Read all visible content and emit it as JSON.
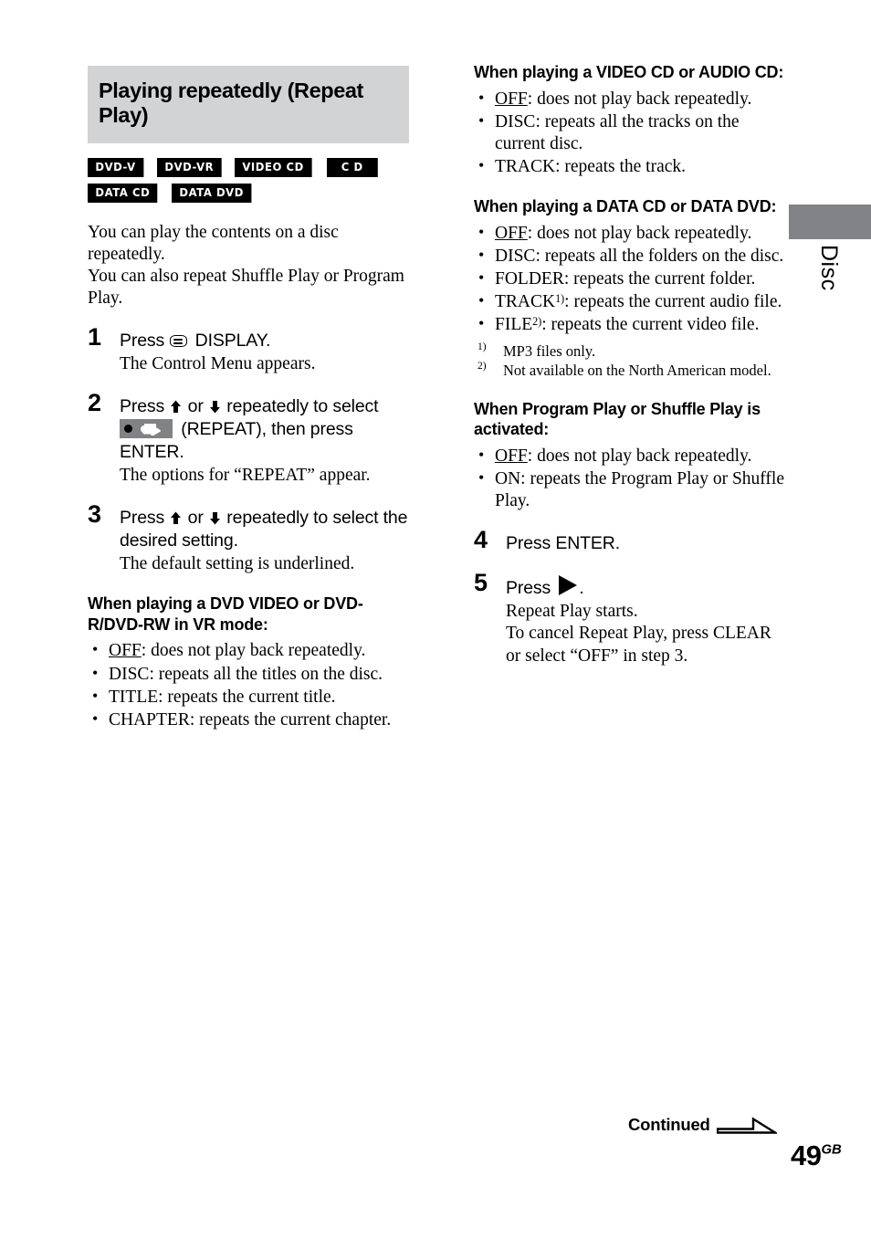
{
  "section": {
    "title": "Playing repeatedly (Repeat Play)",
    "header_bg": "#d2d3d5"
  },
  "disc_badges": [
    {
      "label": "DVD-V"
    },
    {
      "label": "DVD-VR"
    },
    {
      "label": "VIDEO CD"
    },
    {
      "label": "C D"
    },
    {
      "label": "DATA CD"
    },
    {
      "label": "DATA DVD"
    }
  ],
  "intro": {
    "line1": "You can play the contents on a disc repeatedly.",
    "line2": "You can also repeat Shuffle Play or Program Play."
  },
  "steps": {
    "step1": {
      "num": "1",
      "title_before_icon": "Press",
      "icon": "display-icon",
      "title_after_icon": "DISPLAY.",
      "desc": "The Control Menu appears."
    },
    "step2": {
      "num": "2",
      "line1_a": "Press",
      "arrow_up": "up-arrow-icon",
      "line1_b": "or",
      "arrow_down": "down-arrow-icon",
      "line1_c": "repeatedly to select",
      "repeat_icon": "repeat-icon",
      "line2": "(REPEAT), then press ENTER.",
      "desc": "The options for “REPEAT” appear."
    },
    "step3": {
      "num": "3",
      "line1_a": "Press",
      "line1_b": "or",
      "line1_c": "repeatedly to select the desired setting.",
      "desc": "The default setting is underlined."
    },
    "step4": {
      "num": "4",
      "title": "Press ENTER."
    },
    "step5": {
      "num": "5",
      "title_before_icon": "Press",
      "icon": "play-icon",
      "title_after_icon": ".",
      "desc_line1": "Repeat Play starts.",
      "desc_line2": "To cancel Repeat Play, press CLEAR or select “OFF” in step 3."
    }
  },
  "option_groups": [
    {
      "id": "dvd-video",
      "heading": "When playing a DVD VIDEO or DVD-R/DVD-RW in VR mode:",
      "items": [
        {
          "name": "OFF",
          "underlined": true,
          "text": ": does not play back repeatedly."
        },
        {
          "name": "DISC",
          "underlined": false,
          "text": ": repeats all the titles on the disc."
        },
        {
          "name": "TITLE",
          "underlined": false,
          "text": ": repeats the current title."
        },
        {
          "name": "CHAPTER",
          "underlined": false,
          "text": ": repeats the current chapter."
        }
      ]
    },
    {
      "id": "video-cd-audio-cd",
      "heading": "When playing a VIDEO CD or AUDIO CD:",
      "items": [
        {
          "name": "OFF",
          "underlined": true,
          "text": ": does not play back repeatedly."
        },
        {
          "name": "DISC",
          "underlined": false,
          "text": ": repeats all the tracks on the current disc."
        },
        {
          "name": "TRACK",
          "underlined": false,
          "text": ": repeats the track."
        }
      ]
    },
    {
      "id": "data-cd-data-dvd",
      "heading": "When playing a DATA CD or DATA DVD:",
      "items": [
        {
          "name": "OFF",
          "underlined": true,
          "text": ": does not play back repeatedly."
        },
        {
          "name": "DISC",
          "underlined": false,
          "text": ": repeats all the folders on the disc."
        },
        {
          "name": "FOLDER",
          "underlined": false,
          "text": ": repeats the current folder."
        },
        {
          "name": "TRACK",
          "underlined": false,
          "footnote": "1)",
          "text": ": repeats the current audio file."
        },
        {
          "name": "FILE",
          "underlined": false,
          "footnote": "2)",
          "text": ": repeats the current video file."
        }
      ]
    },
    {
      "id": "program-shuffle",
      "heading": "When Program Play or Shuffle Play is activated:",
      "items": [
        {
          "name": "OFF",
          "underlined": true,
          "text": ": does not play back repeatedly."
        },
        {
          "name": "ON",
          "underlined": false,
          "text": ": repeats the Program Play or Shuffle Play."
        }
      ]
    }
  ],
  "footnotes": [
    {
      "marker": "1)",
      "text": "MP3 files only."
    },
    {
      "marker": "2)",
      "text": "Not available on the North American model."
    }
  ],
  "side_tab": {
    "label": "Disc",
    "block_color": "#808285"
  },
  "footer": {
    "continued": "Continued",
    "continued_arrow": "arrow-right-outline-icon",
    "page_number": "49",
    "page_suffix": "GB"
  }
}
